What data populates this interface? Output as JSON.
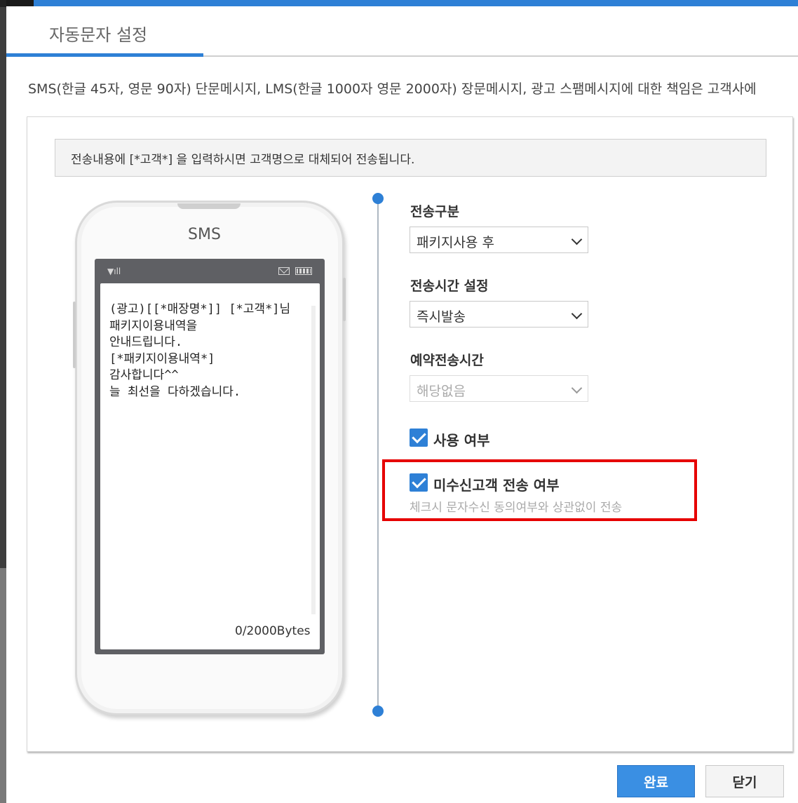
{
  "dialog": {
    "title": "자동문자 설정",
    "notice": "SMS(한글 45자, 영문 90자) 단문메시지, LMS(한글 1000자 영문 2000자) 장문메시지, 광고 스팸메시지에 대한 책임은 고객사에"
  },
  "info_box": {
    "text": "전송내용에 [*고객*] 을 입력하시면 고객명으로 대체되어 전송됩니다."
  },
  "phone": {
    "label": "SMS",
    "message": "(광고)[[*매장명*]] [*고객*]님\n패키지이용내역을\n안내드립니다.\n[*패키지이용내역*]\n감사합니다^^\n늘 최선을 다하겠습니다.",
    "byte_counter": "0/2000Bytes",
    "icons": [
      "signal-icon",
      "mail-icon",
      "battery-icon"
    ]
  },
  "form": {
    "send_type": {
      "label": "전송구분",
      "value": "패키지사용 후"
    },
    "send_time": {
      "label": "전송시간 설정",
      "value": "즉시발송"
    },
    "reserve_time": {
      "label": "예약전송시간",
      "value": "해당없음",
      "disabled": true
    },
    "use_flag": {
      "label": "사용 여부",
      "checked": true
    },
    "non_consent": {
      "label": "미수신고객 전송 여부",
      "checked": true,
      "hint": "체크시 문자수신 동의여부와 상관없이 전송"
    }
  },
  "buttons": {
    "confirm": "완료",
    "close": "닫기"
  },
  "colors": {
    "accent": "#2e80d6",
    "highlight": "#e60000"
  }
}
